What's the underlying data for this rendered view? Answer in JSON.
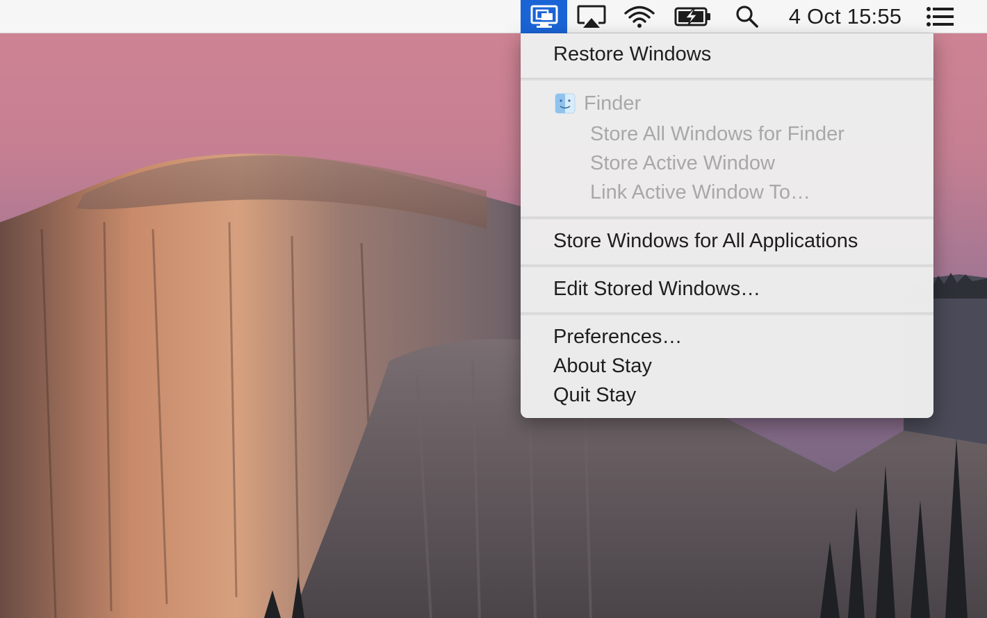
{
  "menubar": {
    "clock": "4 Oct 15:55",
    "icons": [
      "stay-icon",
      "airplay-icon",
      "wifi-icon",
      "battery-charging-icon",
      "spotlight-search-icon",
      "notification-center-icon"
    ],
    "active_color": "#1a64d6"
  },
  "menu": {
    "restore": "Restore Windows",
    "app_name": "Finder",
    "store_all_for_app": "Store All Windows for Finder",
    "store_active": "Store Active Window",
    "link_active": "Link Active Window To…",
    "store_all_apps": "Store Windows for All Applications",
    "edit_stored": "Edit Stored Windows…",
    "preferences": "Preferences…",
    "about": "About Stay",
    "quit": "Quit Stay"
  }
}
